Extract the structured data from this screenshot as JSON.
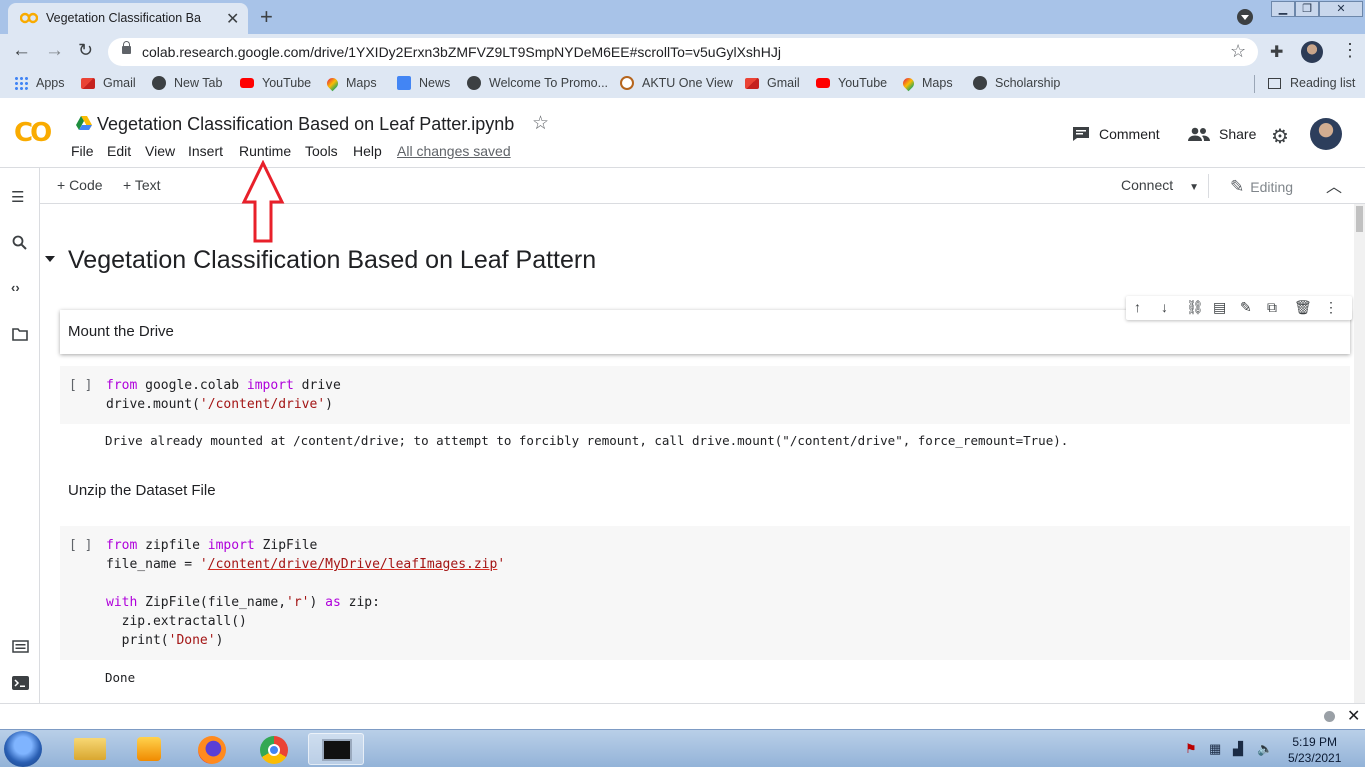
{
  "browser": {
    "tab_title": "Vegetation Classification Based o",
    "url": "colab.research.google.com/drive/1YXIDy2Erxn3bZMFVZ9LT9SmpNYDeM6EE#scrollTo=v5uGylXshHJj",
    "bookmarks": [
      "Apps",
      "Gmail",
      "New Tab",
      "YouTube",
      "Maps",
      "News",
      "Welcome To Promo...",
      "AKTU One View",
      "Gmail",
      "YouTube",
      "Maps",
      "Scholarship"
    ],
    "reading_list": "Reading list"
  },
  "colab": {
    "logo": "CO",
    "notebook_title": "Vegetation Classification Based on Leaf Patter.ipynb",
    "menu": [
      "File",
      "Edit",
      "View",
      "Insert",
      "Runtime",
      "Tools",
      "Help"
    ],
    "save_status": "All changes saved",
    "comment_label": "Comment",
    "share_label": "Share",
    "add_code": "+ Code",
    "add_text": "+ Text",
    "connect_label": "Connect",
    "editing_label": "Editing"
  },
  "notebook": {
    "heading": "Vegetation Classification Based on Leaf Pattern",
    "text_cell_1": "Mount the Drive",
    "run_bracket": "[ ]",
    "output_1": "Drive already mounted at /content/drive; to attempt to forcibly remount, call drive.mount(\"/content/drive\", force_remount=True).",
    "text_cell_2": "Unzip the Dataset File",
    "output_2": "Done"
  },
  "taskbar": {
    "time": "5:19 PM",
    "date": "5/23/2021"
  },
  "colors": {
    "annotation_arrow": "#e8202a",
    "colab_orange": "#f9ab00",
    "keyword": "#af00db",
    "string": "#a31515"
  }
}
